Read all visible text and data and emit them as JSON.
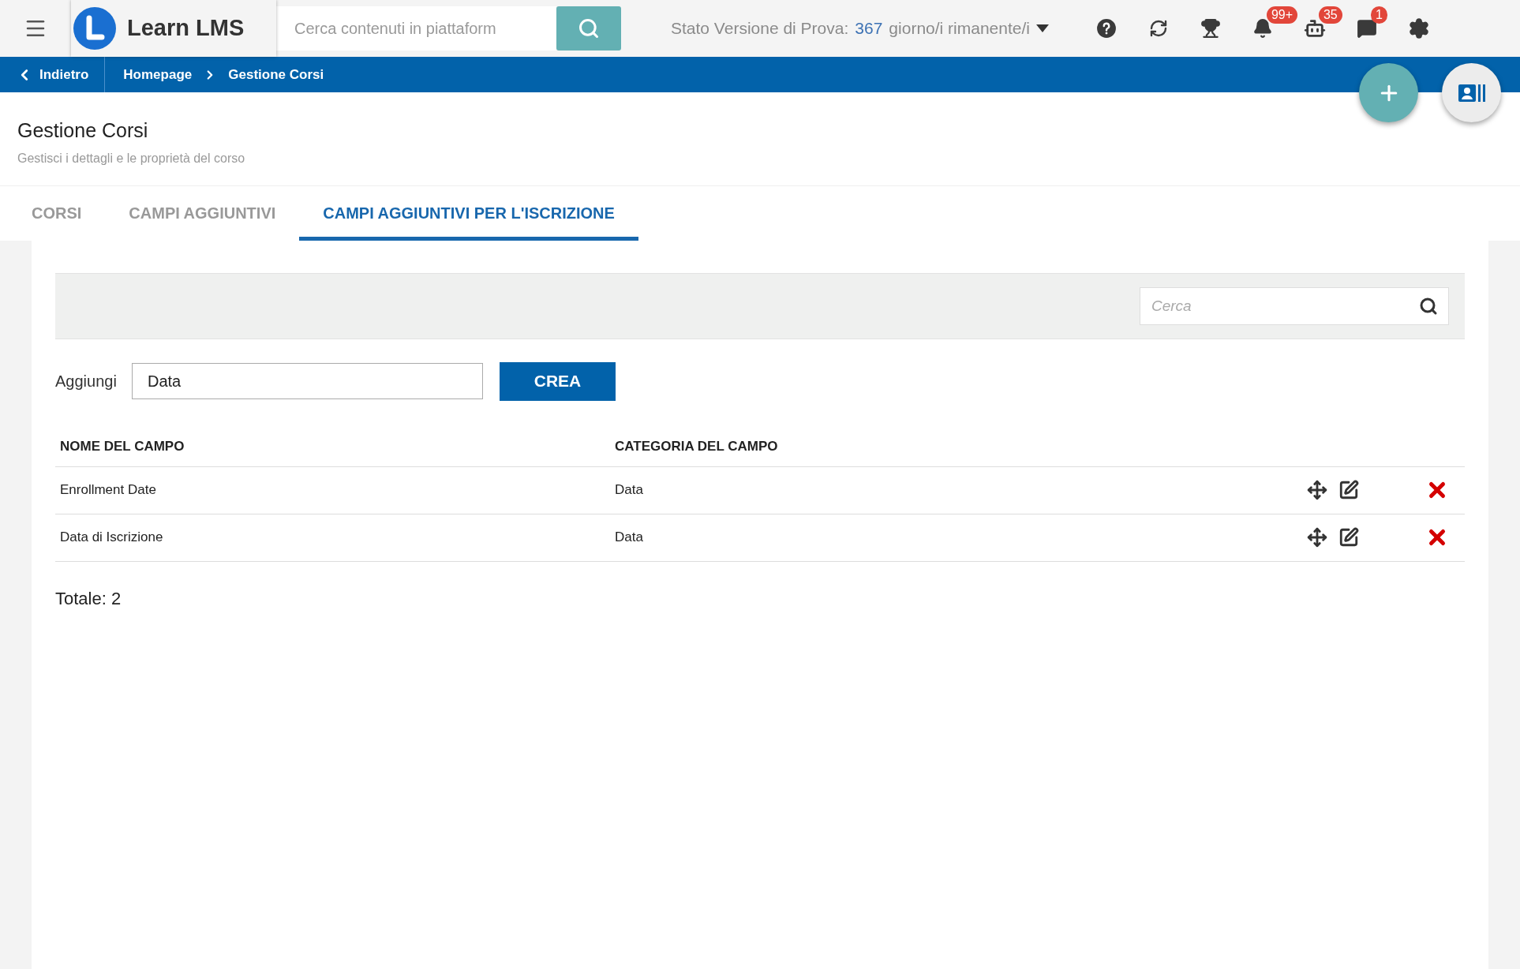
{
  "header": {
    "logo_text": "Learn LMS",
    "search": {
      "placeholder": "Cerca contenuti in piattaform"
    },
    "trial": {
      "prefix": "Stato Versione di Prova:",
      "days": "367",
      "suffix": "giorno/i rimanente/i"
    },
    "icons": [
      {
        "kind": "help"
      },
      {
        "kind": "sync"
      },
      {
        "kind": "trophy"
      },
      {
        "kind": "bell",
        "badge": "99+"
      },
      {
        "kind": "bot",
        "badge": "35"
      },
      {
        "kind": "chat",
        "badge": "1"
      },
      {
        "kind": "settings"
      }
    ]
  },
  "breadcrumb": {
    "back": "Indietro",
    "items": [
      "Homepage",
      "Gestione Corsi"
    ]
  },
  "page": {
    "title": "Gestione Corsi",
    "subtitle": "Gestisci i dettagli e le proprietà del corso"
  },
  "tabs": [
    {
      "label": "CORSI",
      "selected": false
    },
    {
      "label": "CAMPI AGGIUNTIVI",
      "selected": false
    },
    {
      "label": "CAMPI AGGIUNTIVI PER L'ISCRIZIONE",
      "selected": true
    }
  ],
  "filter": {
    "placeholder": "Cerca"
  },
  "add": {
    "label": "Aggiungi",
    "value": "Data",
    "button": "CREA"
  },
  "table": {
    "columns": [
      "NOME DEL CAMPO",
      "CATEGORIA DEL CAMPO"
    ],
    "rows": [
      {
        "cells": [
          "Enrollment Date",
          "Data"
        ]
      },
      {
        "cells": [
          "Data di Iscrizione",
          "Data"
        ]
      }
    ]
  },
  "total": "Totale: 2"
}
